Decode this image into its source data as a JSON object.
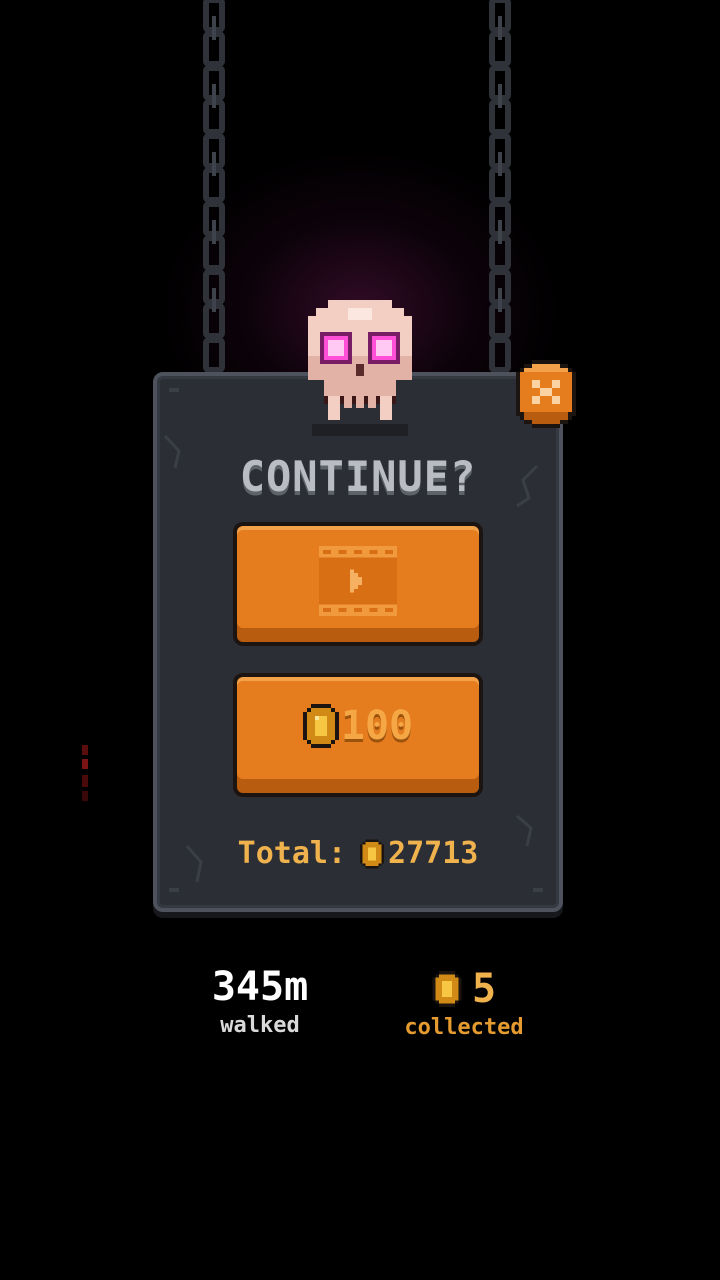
{
  "dialog": {
    "title": "CONTINUE?",
    "close_icon": "close-x-icon",
    "watch_ad_icon": "film-play-icon",
    "coin_cost": "100",
    "total_label": "Total:",
    "total_coins": "27713"
  },
  "stats": {
    "distance": "345m",
    "distance_label": "walked",
    "coins": "5",
    "coins_label": "collected"
  },
  "colors": {
    "accent_orange": "#e57c1e",
    "coin_gold": "#f0b24d",
    "panel": "#2b2e35",
    "skull_eyes": "#ff4fd8"
  }
}
